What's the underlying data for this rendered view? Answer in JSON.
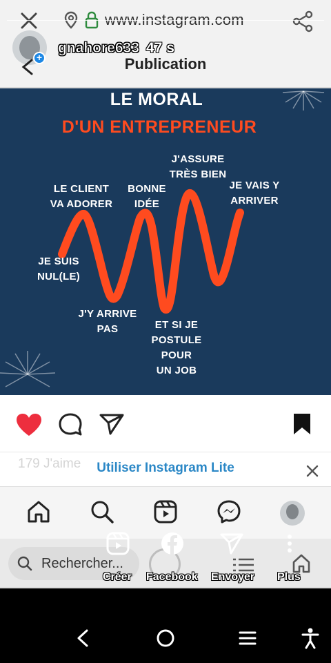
{
  "browser": {
    "url": "www.instagram.com"
  },
  "story": {
    "username": "gnahore633",
    "time": "47 s"
  },
  "page": {
    "heading": "Publication"
  },
  "post": {
    "title_line1": "LE MORAL",
    "title_line2": "D'UN ENTREPRENEUR",
    "labels": [
      {
        "line1": "JE SUIS",
        "line2": "NUL(LE)"
      },
      {
        "line1": "LE CLIENT",
        "line2": "VA ADORER"
      },
      {
        "line1": "J'Y ARRIVE",
        "line2": "PAS"
      },
      {
        "line1": "BONNE",
        "line2": "IDÉE"
      },
      {
        "line1": "J'ASSURE",
        "line2": "TRÈS BIEN"
      },
      {
        "line1": "ET SI JE",
        "line2": "POSTULE POUR",
        "line3": "UN JOB"
      },
      {
        "line1": "JE VAIS Y",
        "line2": "ARRIVER"
      }
    ],
    "colors": {
      "background": "#1a3a5c",
      "wave": "#ff4b1f"
    }
  },
  "actions": {
    "likes_partial": "179 J'aime",
    "liked": true,
    "saved": true
  },
  "banner": {
    "label": "Utiliser Instagram Lite"
  },
  "nav": {
    "items": [
      "home-icon",
      "search-icon",
      "reels-icon",
      "messenger-icon",
      "profile-avatar"
    ]
  },
  "search": {
    "placeholder": "Rechercher..."
  },
  "share_menu": {
    "items": [
      {
        "label": "Créer",
        "icon": "reels-icon"
      },
      {
        "label": "Facebook",
        "icon": "facebook-icon"
      },
      {
        "label": "Envoyer",
        "icon": "send-icon"
      },
      {
        "label": "Plus",
        "icon": "more-icon"
      }
    ]
  }
}
